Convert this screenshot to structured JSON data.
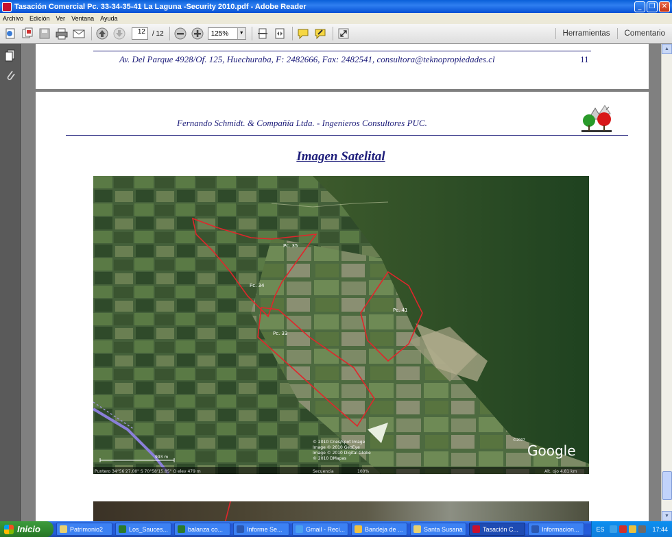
{
  "window": {
    "title": "Tasación Comercial Pc. 33-34-35-41 La Laguna -Security 2010.pdf - Adobe Reader",
    "buttons": [
      "_",
      "❐",
      "✕"
    ]
  },
  "menu": [
    "Archivo",
    "Edición",
    "Ver",
    "Ventana",
    "Ayuda"
  ],
  "toolbar": {
    "current_page": "12",
    "total_pages": "/ 12",
    "zoom": "125%",
    "tools_label": "Herramientas",
    "comment_label": "Comentario"
  },
  "document": {
    "footer_text": "Av. Del Parque 4928/Of. 125, Huechuraba, F: 2482666, Fax: 2482541, consultora@teknopropiedades.cl",
    "page_number": "11",
    "header_text": "Fernando Schmidt. & Compañía Ltda.  - Ingenieros Consultores PUC.",
    "section_title": "Imagen Satelital"
  },
  "satellite": {
    "parcel_labels": [
      "Pc. 35",
      "Pc. 34",
      "Pc. 33",
      "Pc. 41"
    ],
    "copyright_lines": [
      "© 2010 Cnes/Spot Image",
      "Image © 2010 GeoEye",
      "Image © 2010 Digital Globe",
      "© 2010 DMapas"
    ],
    "brand": "Google",
    "brand_year": "©2007",
    "scale": "993 m",
    "status_left": "Puntero  34°56'27.00\" S    70°58'15.85\" O   elev   479 m",
    "status_mid": "Secuencia",
    "status_pct": "100%",
    "status_right": "Alt. ojo    4.81 km"
  },
  "taskbar": {
    "start": "Inicio",
    "tasks": [
      "Patrimonio2",
      "Los_Sauces...",
      "balanza co...",
      "Informe Se...",
      "Gmail - Reci...",
      "Bandeja de ...",
      "Santa Susana",
      "Tasación C...",
      "Informacion..."
    ],
    "lang": "ES",
    "clock": "17:44"
  },
  "colors": {
    "titlebar": "#0a5fd8",
    "doc_text": "#1d1d7a",
    "parcel_outline": "#e0262b"
  }
}
